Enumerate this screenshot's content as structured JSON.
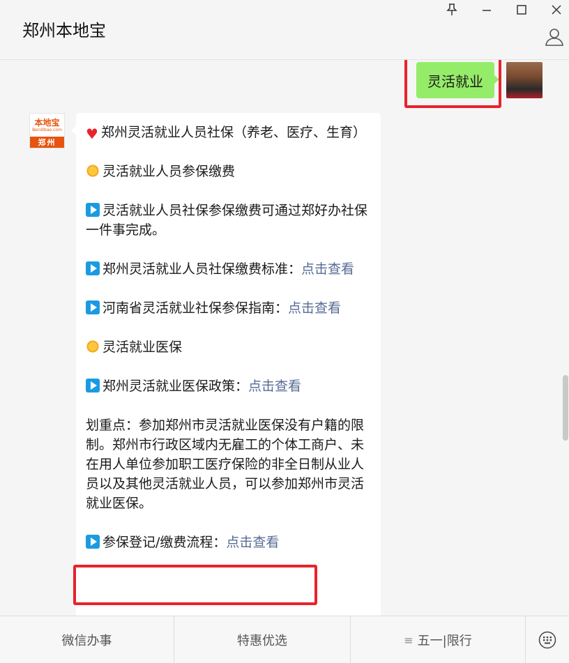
{
  "window": {
    "title": "郑州本地宝",
    "pin_icon": "pin-icon",
    "minimize_icon": "minimize-icon",
    "maximize_icon": "maximize-icon",
    "close_icon": "close-icon",
    "profile_icon": "person-icon"
  },
  "chat": {
    "sent_message": "灵活就业",
    "bot_avatar": {
      "logo_text": "本地宝",
      "logo_sub": "Bendibao.com",
      "city": "郑州"
    },
    "reply": {
      "line1_text": "郑州灵活就业人员社保（养老、医疗、生育）",
      "line2_text": "灵活就业人员参保缴费",
      "line3_text": "灵活就业人员社保参保缴费可通过郑好办社保一件事完成。",
      "line4_text": "郑州灵活就业人员社保缴费标准：",
      "line4_link": "点击查看",
      "line5_text": "河南省灵活就业社保参保指南：",
      "line5_link": "点击查看",
      "line6_text": "灵活就业医保",
      "line7_text": "郑州灵活就业医保政策：",
      "line7_link": "点击查看",
      "line8_text": "划重点：参加郑州市灵活就业医保没有户籍的限制。郑州市行政区域内无雇工的个体工商户、未在用人单位参加职工医疗保险的非全日制从业人员以及其他灵活就业人员，可以参加郑州市灵活就业医保。",
      "line9_text": "参保登记/缴费流程：",
      "line9_link": "点击查看"
    }
  },
  "bottom_menu": {
    "tab1": "微信办事",
    "tab2": "特惠优选",
    "tab3": "五一|限行",
    "tab3_icon": "menu-icon",
    "keyboard_icon": "keyboard-icon"
  },
  "colors": {
    "sent_bubble": "#95ec69",
    "link": "#576b95",
    "highlight_box": "#e8232c",
    "brand": "#e8530f"
  }
}
